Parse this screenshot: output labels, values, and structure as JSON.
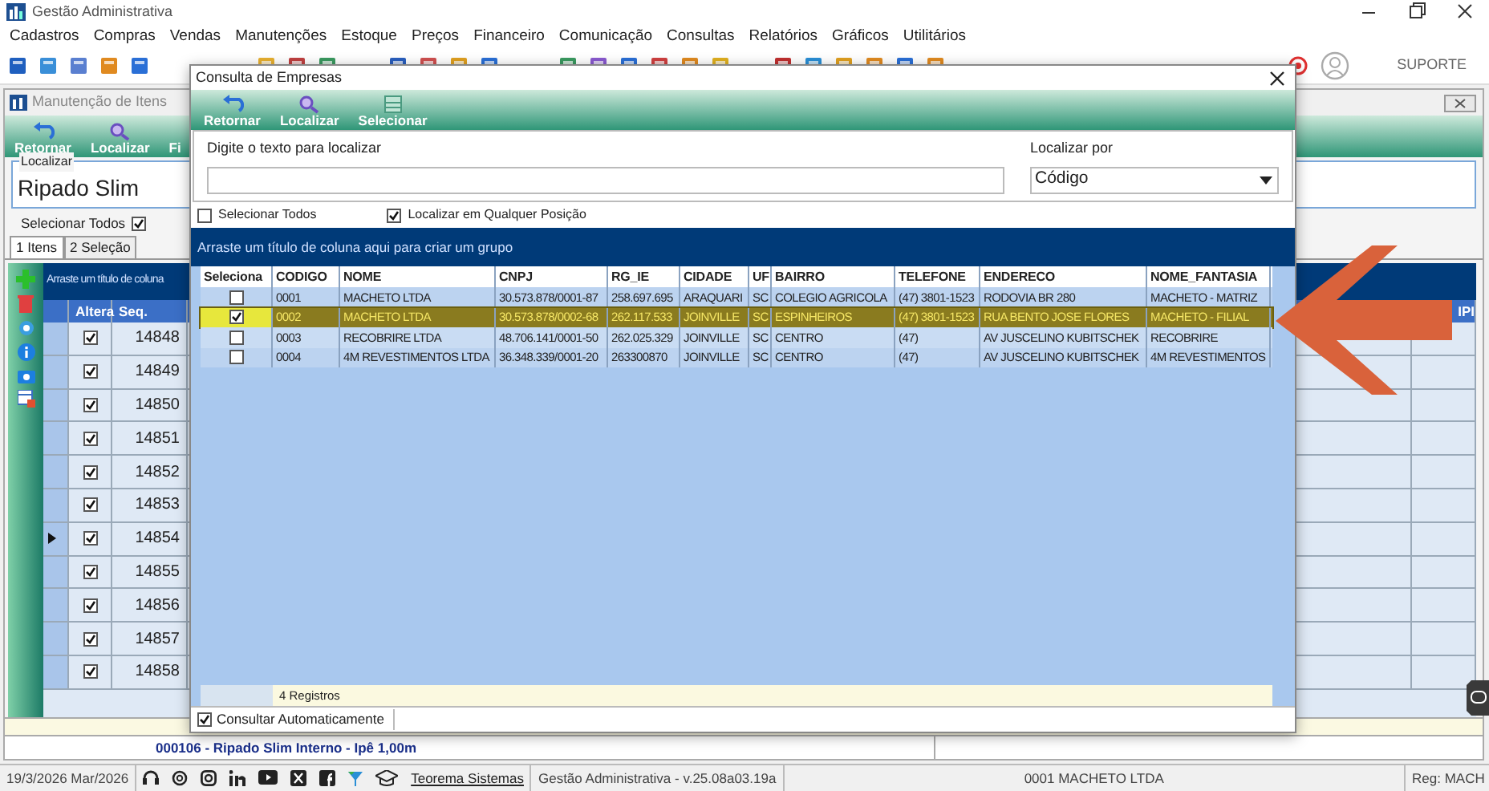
{
  "app": {
    "title": "Gestão Administrativa",
    "menu": [
      "Cadastros",
      "Compras",
      "Vendas",
      "Manutenções",
      "Estoque",
      "Preços",
      "Financeiro",
      "Comunicação",
      "Consultas",
      "Relatórios",
      "Gráficos",
      "Utilitários"
    ],
    "support_label": "SUPORTE"
  },
  "item_window": {
    "title": "Manutenção de Itens",
    "toolbar": [
      {
        "label": "Retornar",
        "kind": "back"
      },
      {
        "label": "Localizar",
        "kind": "search"
      },
      {
        "label": "Fi",
        "kind": "other"
      }
    ],
    "search_legend": "Localizar",
    "search_value": "Ripado Slim",
    "select_all": {
      "label": "Selecionar Todos",
      "checked": true
    },
    "tabs": [
      {
        "label": "1 Itens",
        "selected": true
      },
      {
        "label": "2 Seleção",
        "selected": false
      }
    ],
    "group_hint": "Arraste um título de coluna",
    "columns": [
      "Altera",
      "Seq."
    ],
    "far_column": "IPI",
    "rows": [
      {
        "altera": true,
        "seq": "14848",
        "current": false
      },
      {
        "altera": true,
        "seq": "14849",
        "current": false
      },
      {
        "altera": true,
        "seq": "14850",
        "current": false
      },
      {
        "altera": true,
        "seq": "14851",
        "current": false
      },
      {
        "altera": true,
        "seq": "14852",
        "current": false
      },
      {
        "altera": true,
        "seq": "14853",
        "current": false
      },
      {
        "altera": true,
        "seq": "14854",
        "current": true
      },
      {
        "altera": true,
        "seq": "14855",
        "current": false
      },
      {
        "altera": true,
        "seq": "14856",
        "current": false
      },
      {
        "altera": true,
        "seq": "14857",
        "current": false
      },
      {
        "altera": true,
        "seq": "14858",
        "current": false
      }
    ],
    "info": "000106 - Ripado Slim Interno - Ipê 1,00m"
  },
  "dialog": {
    "title": "Consulta de Empresas",
    "toolbar": [
      {
        "label": "Retornar",
        "kind": "back"
      },
      {
        "label": "Localizar",
        "kind": "search"
      },
      {
        "label": "Selecionar",
        "kind": "select"
      }
    ],
    "search_label": "Digite o texto para localizar",
    "search_by_label": "Localizar por",
    "search_by_value": "Código",
    "select_all": {
      "label": "Selecionar Todos",
      "checked": false
    },
    "any_position": {
      "label": "Localizar em Qualquer Posição",
      "checked": true
    },
    "group_hint": "Arraste um título de coluna aqui para criar um grupo",
    "select_column": "Seleciona",
    "columns": [
      "CODIGO",
      "NOME",
      "CNPJ",
      "RG_IE",
      "CIDADE",
      "UF",
      "BAIRRO",
      "TELEFONE",
      "ENDERECO",
      "NOME_FANTASIA"
    ],
    "rows": [
      {
        "selected": false,
        "checked": false,
        "cells": [
          "0001",
          "MACHETO LTDA",
          "30.573.878/0001-87",
          "258.697.695",
          "ARAQUARI",
          "SC",
          "COLEGIO AGRICOLA",
          "(47) 3801-1523",
          "RODOVIA BR 280",
          "MACHETO - MATRIZ"
        ]
      },
      {
        "selected": true,
        "checked": true,
        "cells": [
          "0002",
          "MACHETO LTDA",
          "30.573.878/0002-68",
          "262.117.533",
          "JOINVILLE",
          "SC",
          "ESPINHEIROS",
          "(47) 3801-1523",
          "RUA BENTO JOSE FLORES",
          "MACHETO - FILIAL"
        ]
      },
      {
        "selected": false,
        "checked": false,
        "cells": [
          "0003",
          "RECOBRIRE LTDA",
          "48.706.141/0001-50",
          "262.025.329",
          "JOINVILLE",
          "SC",
          "CENTRO",
          "(47)",
          "AV JUSCELINO KUBITSCHEK",
          "RECOBRIRE"
        ]
      },
      {
        "selected": false,
        "checked": false,
        "cells": [
          "0004",
          "4M REVESTIMENTOS LTDA",
          "36.348.339/0001-20",
          "263300870",
          "JOINVILLE",
          "SC",
          "CENTRO",
          "(47)",
          "AV JUSCELINO KUBITSCHEK",
          "4M REVESTIMENTOS"
        ]
      }
    ],
    "record_count": "4 Registros",
    "auto_query": {
      "label": "Consultar Automaticamente",
      "checked": true
    }
  },
  "status_bar": {
    "date": "19/3/2026 Mar/2026",
    "link": "Teorema Sistemas",
    "version": "Gestão Administrativa - v.25.08a03.19a",
    "company": "0001 MACHETO LTDA",
    "reg": "Reg: MACH"
  }
}
